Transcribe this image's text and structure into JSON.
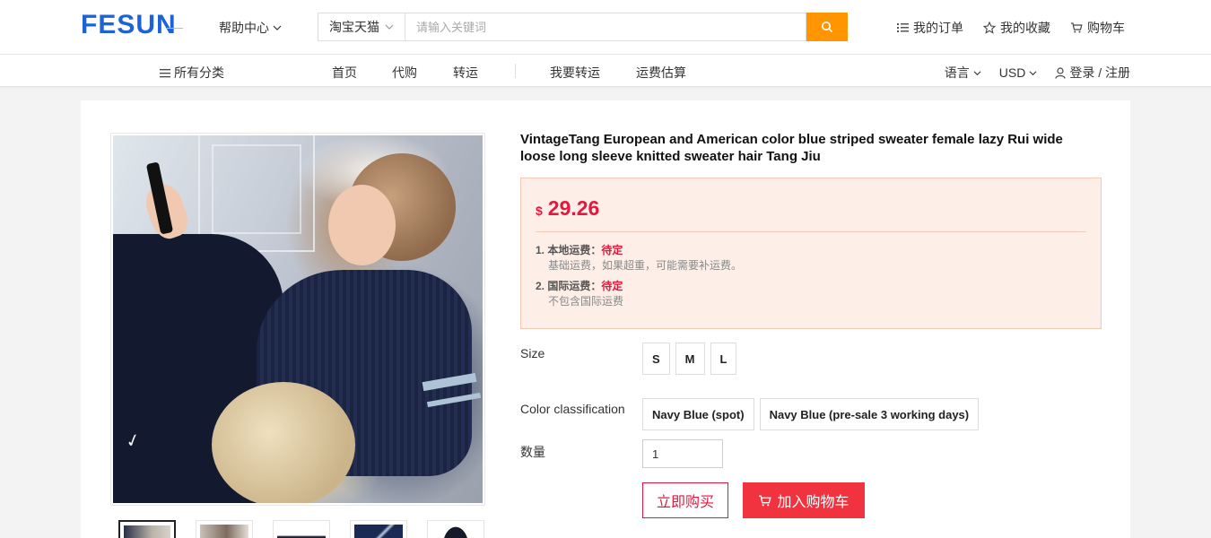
{
  "header": {
    "logo": "FESUN",
    "help": "帮助中心",
    "search": {
      "source": "淘宝天猫",
      "placeholder": "请输入关键词"
    },
    "links": {
      "orders": "我的订单",
      "favorites": "我的收藏",
      "cart": "购物车"
    }
  },
  "nav": {
    "categories": "所有分类",
    "items": [
      "首页",
      "代购",
      "转运",
      "我要转运",
      "运费估算"
    ],
    "language": "语言",
    "currency": "USD",
    "login": "登录 / 注册"
  },
  "product": {
    "title": "VintageTang European and American color blue striped sweater female lazy Rui wide loose long sleeve knitted sweater hair Tang Jiu",
    "currency_symbol": "$",
    "price": "29.26",
    "shipping": {
      "local_label": "1. 本地运费：",
      "local_status": "待定",
      "local_note": "基础运费，如果超重，可能需要补运费。",
      "intl_label": "2. 国际运费：",
      "intl_status": "待定",
      "intl_note": "不包含国际运费"
    },
    "size_label": "Size",
    "sizes": [
      "S",
      "M",
      "L"
    ],
    "color_label": "Color classification",
    "colors": [
      "Navy Blue (spot)",
      "Navy Blue (pre-sale 3 working days)"
    ],
    "qty_label": "数量",
    "qty_value": "1",
    "buy_now": "立即购买",
    "add_to_cart": "加入购物车",
    "thumbnails": 5
  },
  "colors": {
    "brand": "#1e63d6",
    "search_button": "#ff9500",
    "price": "#e5173f",
    "cart_button": "#f1323f"
  }
}
